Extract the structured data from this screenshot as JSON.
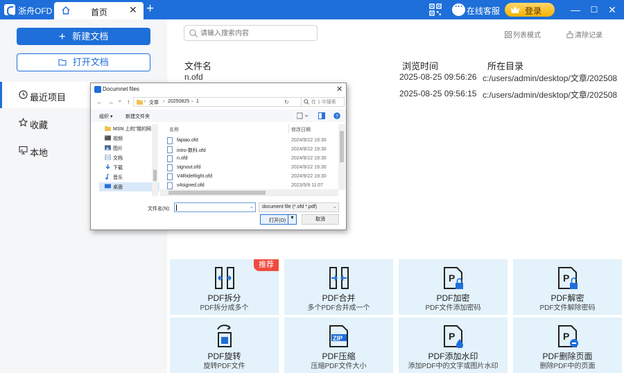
{
  "titlebar": {
    "app_name": "浙舟OFD",
    "tab_home": "首页",
    "tab_close": "✕",
    "tab_add": "+",
    "service_label": "在线客服",
    "login_label": "登录",
    "minimize": "—",
    "maximize": "☐",
    "close": "✕",
    "accent": "#1e6fd9"
  },
  "sidebar": {
    "new_doc": "新建文档",
    "open_doc": "打开文档",
    "nav": [
      {
        "label": "最近项目",
        "icon": "clock-icon"
      },
      {
        "label": "收藏",
        "icon": "star-icon"
      },
      {
        "label": "本地",
        "icon": "monitor-icon"
      }
    ]
  },
  "main": {
    "search_placeholder": "请输入搜索内容",
    "list_mode": "列表模式",
    "clear_records": "清除记录",
    "columns": [
      "文件名",
      "浏览时间",
      "所在目录"
    ],
    "rows": [
      {
        "name": "n.ofd",
        "time": "2025-08-25 09:56:26",
        "dir": "c:/users/admin/desktop/文章/202508"
      },
      {
        "name": "",
        "time": "2025-08-25 09:56:15",
        "dir": "c:/users/admin/desktop/文章/202508"
      }
    ]
  },
  "tools": {
    "badge": "推荐",
    "cards": [
      {
        "title": "PDF拆分",
        "sub": "PDF拆分成多个",
        "icon": "split-icon"
      },
      {
        "title": "PDF合并",
        "sub": "多个PDF合并成一个",
        "icon": "merge-icon"
      },
      {
        "title": "PDF加密",
        "sub": "PDF文件添加密码",
        "icon": "lock-icon"
      },
      {
        "title": "PDF解密",
        "sub": "PDF文件解除密码",
        "icon": "unlock-icon"
      },
      {
        "title": "PDF旋转",
        "sub": "旋转PDF文件",
        "icon": "rotate-icon"
      },
      {
        "title": "PDF压缩",
        "sub": "压缩PDF文件大小",
        "icon": "zip-icon"
      },
      {
        "title": "PDF添加水印",
        "sub": "添加PDF中的文字或图片水印",
        "icon": "watermark-icon"
      },
      {
        "title": "PDF删除页面",
        "sub": "删除PDF中的页面",
        "icon": "delete-page-icon"
      }
    ]
  },
  "dialog": {
    "title": "Documnet files",
    "close": "✕",
    "nav_back": "←",
    "nav_forward": "→",
    "nav_dropdown": "⌄",
    "nav_up": "↑",
    "path": [
      "文章",
      "20250825",
      "1"
    ],
    "path_sep": "›",
    "refresh": "↻",
    "search_placeholder": "在 1 中搜索",
    "organize": "组织 ▾",
    "new_folder": "新建文件夹",
    "tree": [
      {
        "label": "MSN 上的\"我的网",
        "icon": "folder-icon"
      },
      {
        "label": "视频",
        "icon": "video-icon"
      },
      {
        "label": "图片",
        "icon": "picture-icon"
      },
      {
        "label": "文档",
        "icon": "document-icon"
      },
      {
        "label": "下载",
        "icon": "download-icon"
      },
      {
        "label": "音乐",
        "icon": "music-icon"
      },
      {
        "label": "桌面",
        "icon": "desktop-icon"
      }
    ],
    "col_name": "名称",
    "col_date": "修改日期",
    "files": [
      {
        "name": "fapiao.ofd",
        "date": "2024/9/22 19:30"
      },
      {
        "name": "intro-数科.ofd",
        "date": "2024/9/22 19:30"
      },
      {
        "name": "n.ofd",
        "date": "2024/9/22 19:30"
      },
      {
        "name": "signout.ofd",
        "date": "2024/9/22 19:30"
      },
      {
        "name": "V4RideRight.ofd",
        "date": "2024/9/22 19:30"
      },
      {
        "name": "v4signed.ofd",
        "date": "2023/5/9 11:07"
      }
    ],
    "filename_label": "文件名(N):",
    "filename_value": "",
    "filter": "document file (*.ofd *.pdf)",
    "open_button": "打开(O)",
    "cancel_button": "取消"
  }
}
